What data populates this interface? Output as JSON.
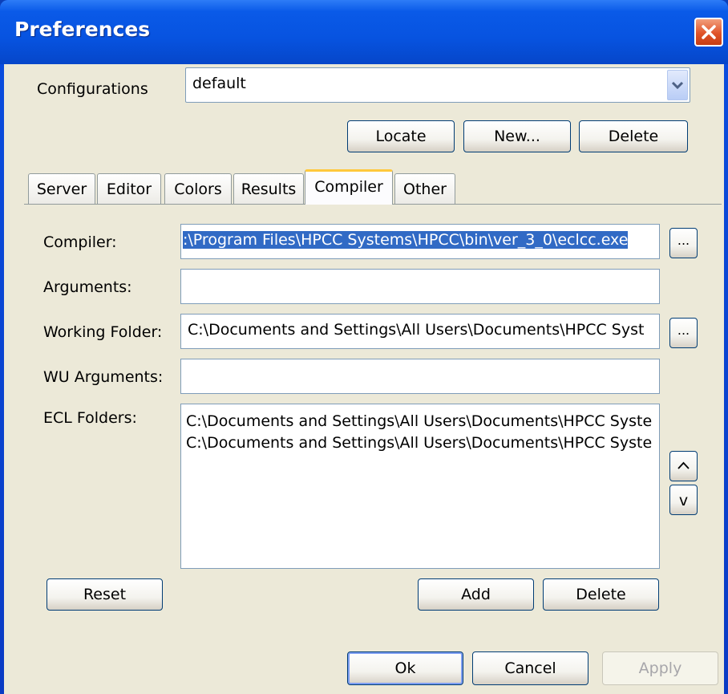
{
  "window": {
    "title": "Preferences",
    "close_glyph": "✕"
  },
  "configurations": {
    "label": "Configurations",
    "value": "default",
    "arrow_glyph": "▾",
    "buttons": {
      "locate": "Locate",
      "new": "New...",
      "delete": "Delete"
    }
  },
  "tabs": [
    {
      "label": "Server"
    },
    {
      "label": "Editor"
    },
    {
      "label": "Colors"
    },
    {
      "label": "Results"
    },
    {
      "label": "Compiler",
      "active": true
    },
    {
      "label": "Other"
    }
  ],
  "compiler_tab": {
    "compiler_label": "Compiler:",
    "compiler_value": ":\\Program Files\\HPCC Systems\\HPCC\\bin\\ver_3_0\\eclcc.exe",
    "browse_label": "...",
    "arguments_label": "Arguments:",
    "arguments_value": "",
    "working_folder_label": "Working Folder:",
    "working_folder_value": "C:\\Documents and Settings\\All Users\\Documents\\HPCC Syst",
    "wu_arguments_label": "WU Arguments:",
    "wu_arguments_value": "",
    "ecl_folders_label": "ECL Folders:",
    "ecl_folders": [
      "C:\\Documents and Settings\\All Users\\Documents\\HPCC Syste",
      "C:\\Documents and Settings\\All Users\\Documents\\HPCC Syste"
    ],
    "move_up": "^",
    "move_down": "v",
    "reset": "Reset",
    "add": "Add",
    "delete": "Delete"
  },
  "footer": {
    "ok": "Ok",
    "cancel": "Cancel",
    "apply": "Apply"
  }
}
